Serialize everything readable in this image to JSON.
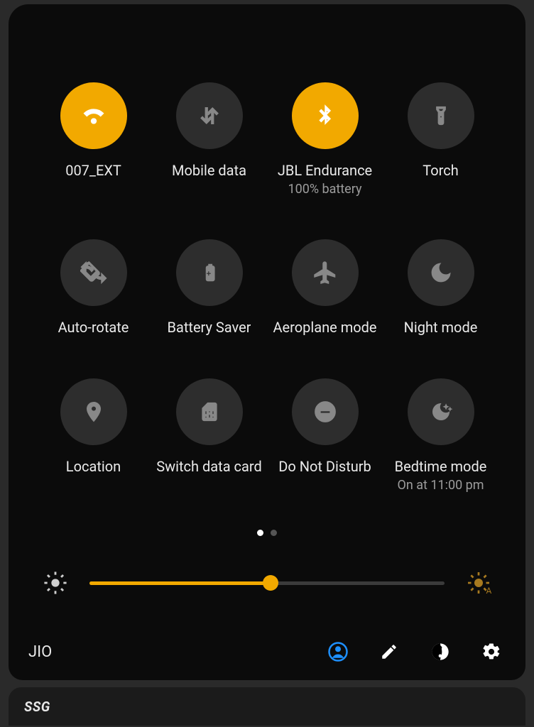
{
  "colors": {
    "accent": "#f2a900"
  },
  "tiles": [
    {
      "id": "wifi",
      "label": "007_EXT",
      "sub": "",
      "active": true
    },
    {
      "id": "mobile-data",
      "label": "Mobile data",
      "sub": "",
      "active": false
    },
    {
      "id": "bluetooth",
      "label": "JBL Endurance",
      "sub": "100% battery",
      "active": true
    },
    {
      "id": "torch",
      "label": "Torch",
      "sub": "",
      "active": false
    },
    {
      "id": "auto-rotate",
      "label": "Auto-rotate",
      "sub": "",
      "active": false
    },
    {
      "id": "battery-saver",
      "label": "Battery Saver",
      "sub": "",
      "active": false
    },
    {
      "id": "aeroplane",
      "label": "Aeroplane mode",
      "sub": "",
      "active": false
    },
    {
      "id": "night-mode",
      "label": "Night mode",
      "sub": "",
      "active": false
    },
    {
      "id": "location",
      "label": "Location",
      "sub": "",
      "active": false
    },
    {
      "id": "switch-sim",
      "label": "Switch data card",
      "sub": "",
      "active": false
    },
    {
      "id": "dnd",
      "label": "Do Not Disturb",
      "sub": "",
      "active": false
    },
    {
      "id": "bedtime",
      "label": "Bedtime mode",
      "sub": "On at 11:00 pm",
      "active": false
    }
  ],
  "pager": {
    "pages": 2,
    "current": 0
  },
  "brightness": {
    "value": 51
  },
  "footer": {
    "carrier": "JIO"
  },
  "notification": {
    "title": "SSG"
  }
}
